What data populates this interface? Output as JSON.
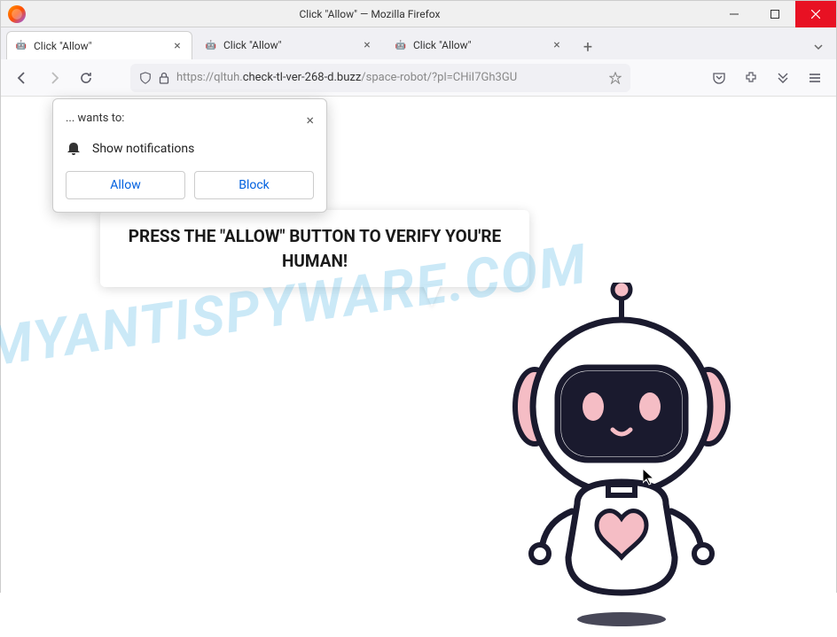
{
  "window": {
    "title": "Click \"Allow\" — Mozilla Firefox"
  },
  "tabs": [
    {
      "title": "Click \"Allow\"",
      "active": true
    },
    {
      "title": "Click \"Allow\"",
      "active": false
    },
    {
      "title": "Click \"Allow\"",
      "active": false
    }
  ],
  "url": {
    "prefix": "https://qltuh.",
    "domain": "check-tl-ver-268-d.buzz",
    "path": "/space-robot/?pl=CHiI7Gh3GU"
  },
  "permission": {
    "wants_to": "... wants to:",
    "message": "Show notifications",
    "allow": "Allow",
    "block": "Block"
  },
  "page": {
    "headline": "PRESS THE \"ALLOW\" BUTTON TO VERIFY YOU'RE HUMAN!"
  },
  "watermark": "MYANTISPYWARE.COM"
}
